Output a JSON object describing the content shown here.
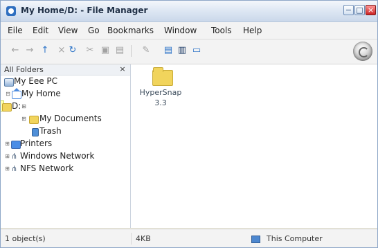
{
  "window": {
    "title": "My Home/D: - File Manager"
  },
  "menu": [
    "Eile",
    "Edit",
    "View",
    "Go",
    "Bookmarks",
    "Window",
    "Tools",
    "Help"
  ],
  "toolbar": {
    "icons": [
      "back-arrow-icon",
      "forward-arrow-icon",
      "up-arrow-icon",
      "stop-icon",
      "refresh-icon",
      "cut-icon",
      "copy-icon",
      "paste-icon",
      "rename-icon",
      "view-mode-icon",
      "split-view-icon",
      "sidebar-toggle-icon"
    ]
  },
  "sidebar": {
    "title": "All Folders",
    "items": [
      {
        "label": "My Eee PC"
      },
      {
        "label": "My Home"
      },
      {
        "label": "D:"
      },
      {
        "label": "My Documents"
      },
      {
        "label": "Trash"
      },
      {
        "label": "Printers"
      },
      {
        "label": "Windows Network"
      },
      {
        "label": "NFS Network"
      }
    ]
  },
  "main": {
    "items": [
      {
        "name_line1": "HyperSnap",
        "name_line2": "3.3"
      }
    ]
  },
  "status": {
    "count": "1 object(s)",
    "size": "4KB",
    "location": "This Computer"
  },
  "colors": {
    "selection": "#ffffb0",
    "titlebar": "#dfe8f4",
    "folder": "#f1d45c",
    "close": "#cc2222"
  }
}
